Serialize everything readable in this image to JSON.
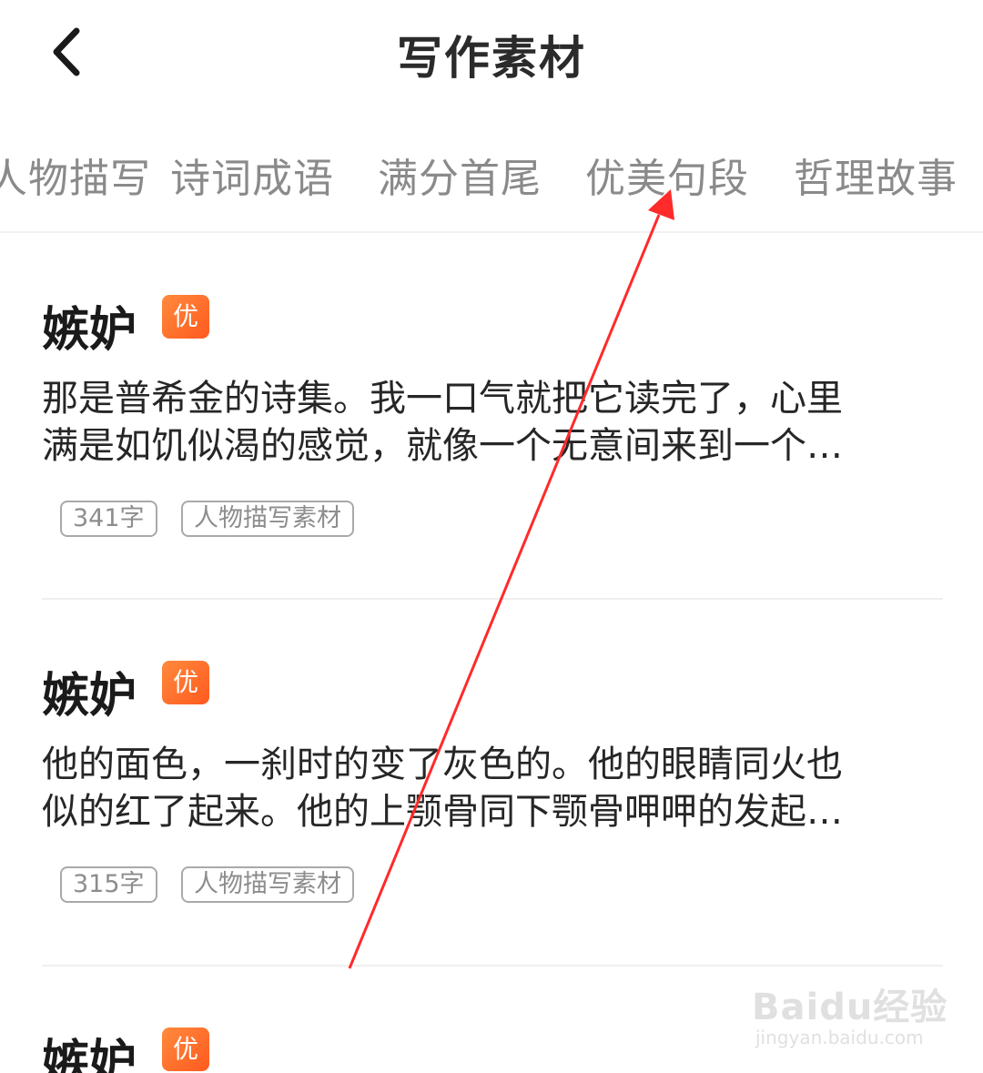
{
  "header": {
    "title": "写作素材",
    "back_icon": "chevron-left-icon"
  },
  "tabs": [
    {
      "label": "人物描写"
    },
    {
      "label": "诗词成语"
    },
    {
      "label": "满分首尾"
    },
    {
      "label": "优美句段"
    },
    {
      "label": "哲理故事"
    }
  ],
  "cards": [
    {
      "title": "嫉妒",
      "badge": "优",
      "excerpt_line1": "那是普希金的诗集。我一口气就把它读完了，心里",
      "excerpt_line2": "满是如饥似渴的感觉，就像一个无意间来到一个…",
      "word_count": "341字",
      "category": "人物描写素材"
    },
    {
      "title": "嫉妒",
      "badge": "优",
      "excerpt_line1": "他的面色，一刹时的变了灰色的。他的眼睛同火也",
      "excerpt_line2": "似的红了起来。他的上颚骨同下颚骨呷呷的发起…",
      "word_count": "315字",
      "category": "人物描写素材"
    },
    {
      "title": "嫉妒",
      "badge": "优"
    }
  ],
  "watermark": {
    "main": "Baidu经验",
    "sub": "jingyan.baidu.com"
  },
  "colors": {
    "badge": "#ff6a2a",
    "annotation_arrow": "#ff2a2a",
    "tab_text": "#8a8a8a"
  }
}
